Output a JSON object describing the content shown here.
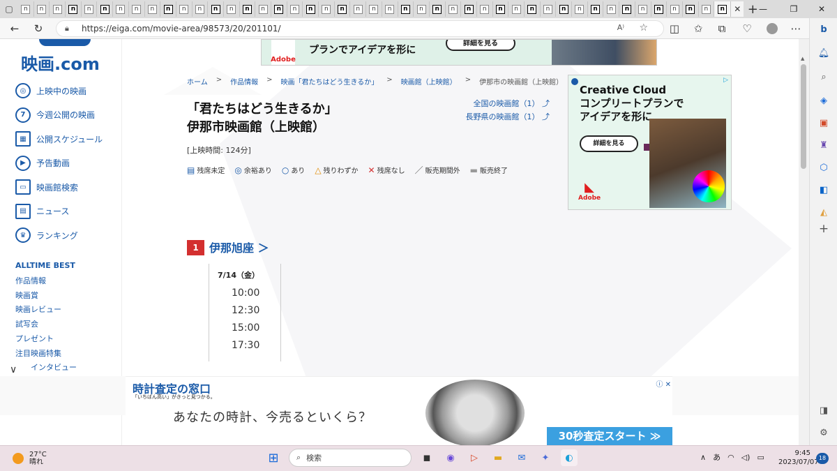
{
  "browser": {
    "url": "https://eiga.com/movie-area/98573/20/201101/",
    "tab_favicon_letter": "n",
    "tab_dark_indices": [
      3,
      5,
      9,
      12,
      14,
      16,
      18,
      20,
      24,
      26,
      28,
      30,
      32,
      34,
      36,
      38,
      40,
      42,
      44
    ],
    "tab_count": 45
  },
  "site": {
    "logo": "映画.com",
    "nav": [
      {
        "label": "上映中の映画",
        "icon": "film-reel-icon",
        "glyph": "◎"
      },
      {
        "label": "今週公開の映画",
        "icon": "calendar-7-icon",
        "glyph": "7"
      },
      {
        "label": "公開スケジュール",
        "icon": "schedule-grid-icon",
        "glyph": "▦"
      },
      {
        "label": "予告動画",
        "icon": "play-icon",
        "glyph": "▶"
      },
      {
        "label": "映画館検索",
        "icon": "theater-search-icon",
        "glyph": "▭"
      },
      {
        "label": "ニュース",
        "icon": "news-icon",
        "glyph": "▤"
      },
      {
        "label": "ランキング",
        "icon": "crown-icon",
        "glyph": "♛"
      }
    ],
    "alltime": "ALLTIME BEST",
    "sublinks": [
      "作品情報",
      "映画賞",
      "映画レビュー",
      "試写会",
      "プレゼント",
      "注目映画特集",
      "インタビュー"
    ]
  },
  "breadcrumb": {
    "items": [
      "ホーム",
      "作品情報",
      "映画「君たちはどう生きるか」",
      "映画館（上映館）"
    ],
    "current": "伊那市の映画館（上映館）",
    "sep": ">"
  },
  "title": {
    "line1": "「君たちはどう生きるか」",
    "line2": "伊那市映画館（上映館）"
  },
  "theater_links": {
    "national": "全国の映画館（1）",
    "prefecture": "長野県の映画館（1）"
  },
  "runtime": "[上映時間: 124分]",
  "legend": [
    {
      "symbol": "▤",
      "label": "残席未定",
      "color": "#1a5aa8"
    },
    {
      "symbol": "◎",
      "label": "余裕あり",
      "color": "#1a5aa8"
    },
    {
      "symbol": "○",
      "label": "あり",
      "color": "#1a5aa8"
    },
    {
      "symbol": "△",
      "label": "残りわずか",
      "color": "#e08a00"
    },
    {
      "symbol": "✕",
      "label": "残席なし",
      "color": "#d32f2f"
    },
    {
      "symbol": "／",
      "label": "販売期間外",
      "color": "#555555"
    },
    {
      "symbol": "▬",
      "label": "販売終了",
      "color": "#999999"
    }
  ],
  "theater": {
    "number": "1",
    "name": "伊那旭座 ＞",
    "date": "7/14（金）",
    "times": [
      "10:00",
      "12:30",
      "15:00",
      "17:30"
    ]
  },
  "ads": {
    "top_banner": {
      "text": "プランでアイデアを形に",
      "button": "詳細を見る",
      "brand": "Adobe"
    },
    "side": {
      "headline": [
        "Creative Cloud",
        "コンプリートプランで",
        "アイデアを形に"
      ],
      "button": "詳細を見る",
      "brand": "Adobe"
    },
    "bottom": {
      "heading": "時計査定の窓口",
      "sub": "「いちばん高い」がきっと見つかる。",
      "main": "あなたの時計、今売るといくら？",
      "cta": "30秒査定スタート ≫"
    }
  },
  "taskbar": {
    "temp": "27°C",
    "weather": "晴れ",
    "search_placeholder": "検索",
    "ime": "あ",
    "time": "9:45",
    "date": "2023/07/07",
    "notifications": "18"
  }
}
